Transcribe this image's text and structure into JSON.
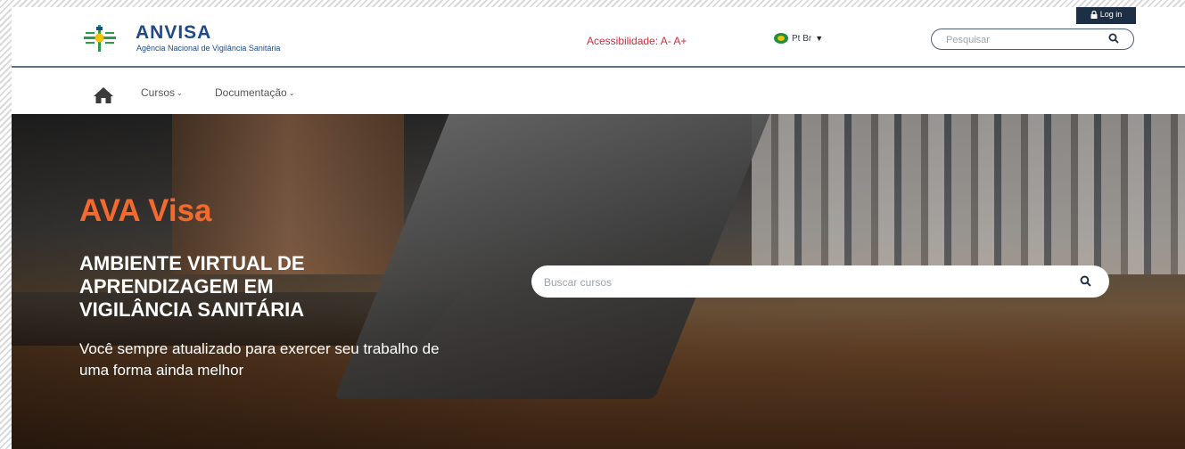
{
  "header": {
    "brand_name": "ANVISA",
    "brand_subtitle": "Agência Nacional de Vigilância Sanitária",
    "accessibility_label": "Acessibilidade: A- A+",
    "language": "Pt Br",
    "search_placeholder": "Pesquisar",
    "login_label": "Log in"
  },
  "nav": {
    "items": [
      {
        "label": "Cursos"
      },
      {
        "label": "Documentação"
      }
    ]
  },
  "hero": {
    "title": "AVA Visa",
    "subtitle": "AMBIENTE VIRTUAL DE\nAPRENDIZAGEM EM\nVIGILÂNCIA SANITÁRIA",
    "text": "Você sempre atualizado para exercer seu trabalho de uma forma ainda melhor",
    "search_placeholder": "Buscar cursos"
  },
  "colors": {
    "brand_blue": "#1f4a85",
    "accent_orange": "#f26a2e",
    "accessibility_red": "#c7303a",
    "login_bg": "#1c2f44"
  },
  "icons": [
    "anvisa-logo-icon",
    "flag-icon",
    "search-icon",
    "lock-icon",
    "home-icon",
    "chevron-down-icon"
  ]
}
